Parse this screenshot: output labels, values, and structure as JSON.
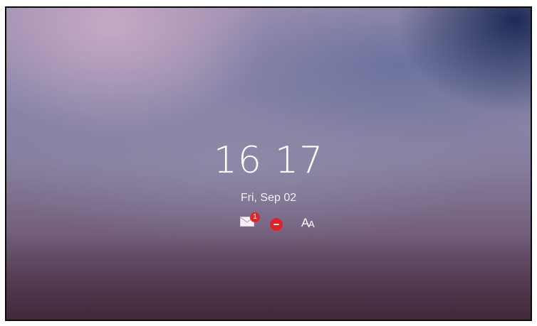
{
  "lockscreen": {
    "time_hours": "16",
    "time_minutes": "17",
    "date": "Fri, Sep 02",
    "status_icons": {
      "message_icon": "envelope-icon",
      "message_count": "1",
      "dnd_icon": "do-not-disturb-icon",
      "font_icon": "font-size-icon",
      "font_big": "A",
      "font_small": "A"
    },
    "colors": {
      "badge": "#e0262a",
      "dnd": "#e22028",
      "text": "#ffffff",
      "frame": "#0b0b0b"
    }
  }
}
